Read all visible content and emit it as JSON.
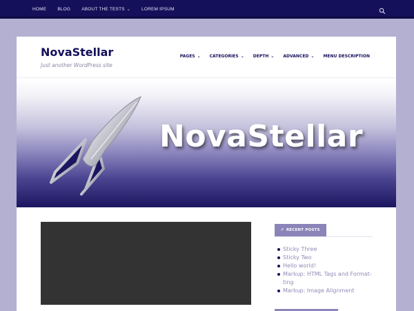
{
  "colors": {
    "accent": "#14105a",
    "widget": "#8a84b8",
    "link": "#8f8bb8",
    "page_bg": "#b3b0d1"
  },
  "topbar": {
    "items": [
      {
        "label": "HOME"
      },
      {
        "label": "BLOG"
      },
      {
        "label": "ABOUT THE TESTS",
        "has_dropdown": true,
        "chevron": "⌄"
      },
      {
        "label": "LOREM IPSUM"
      }
    ],
    "search_icon": "search-icon"
  },
  "header": {
    "site_title": "NovaStellar",
    "tagline": "Just another WordPress site",
    "nav": [
      {
        "label": "PAGES",
        "chevron": "⌄"
      },
      {
        "label": "CATEGORIES",
        "chevron": "⌄"
      },
      {
        "label": "DEPTH",
        "chevron": "⌄"
      },
      {
        "label": "ADVANCED",
        "chevron": "⌄"
      },
      {
        "label": "MENU DESCRIPTION"
      }
    ]
  },
  "banner": {
    "title": "NovaStellar",
    "image_icon": "rocket-icon"
  },
  "sidebar": {
    "widget_title": "RECENT POSTS",
    "widget_icon": "pin-icon",
    "posts": [
      {
        "label": "Sticky Three"
      },
      {
        "label": "Sticky Two"
      },
      {
        "label": "Hello world!"
      },
      {
        "label": "Markup: HTML Tags and Format-ting"
      },
      {
        "label": "Markup: Image Alignment"
      }
    ]
  }
}
